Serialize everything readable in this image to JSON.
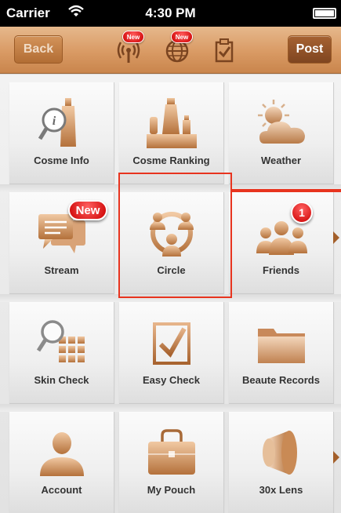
{
  "status_bar": {
    "carrier": "Carrier",
    "time": "4:30 PM"
  },
  "nav": {
    "back_label": "Back",
    "post_label": "Post",
    "icons": [
      {
        "name": "antenna-icon",
        "badge": "New"
      },
      {
        "name": "globe-icon",
        "badge": "New"
      },
      {
        "name": "clipboard-check-icon"
      }
    ]
  },
  "grid": {
    "items": [
      {
        "label": "Cosme Info",
        "icon": "cosme-info-icon"
      },
      {
        "label": "Cosme Ranking",
        "icon": "cosme-ranking-icon"
      },
      {
        "label": "Weather",
        "icon": "weather-icon"
      },
      {
        "label": "Stream",
        "icon": "stream-icon",
        "badge": "New"
      },
      {
        "label": "Circle",
        "icon": "circle-icon"
      },
      {
        "label": "Friends",
        "icon": "friends-icon",
        "badge": "1"
      },
      {
        "label": "Skin Check",
        "icon": "skin-check-icon"
      },
      {
        "label": "Easy Check",
        "icon": "easy-check-icon"
      },
      {
        "label": "Beaute Records",
        "icon": "folder-icon"
      },
      {
        "label": "Account",
        "icon": "account-icon"
      },
      {
        "label": "My Pouch",
        "icon": "pouch-icon"
      },
      {
        "label": "30x Lens",
        "icon": "lens-icon"
      }
    ]
  },
  "colors": {
    "accent": "#d99a64",
    "highlight": "#e8341f",
    "badge": "#cc0000"
  }
}
